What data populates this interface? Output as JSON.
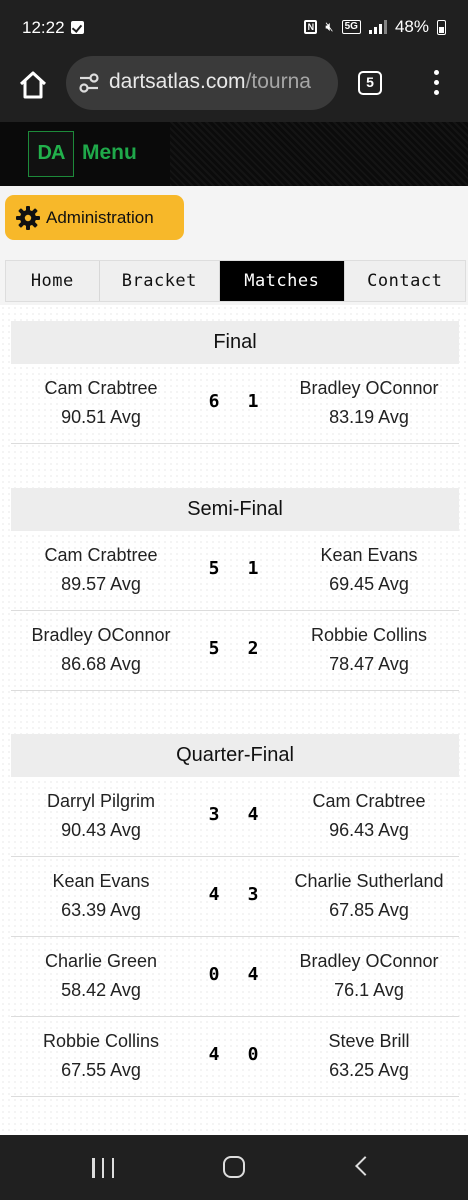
{
  "status_bar": {
    "time": "12:22",
    "battery": "48%",
    "network": "5G"
  },
  "browser": {
    "url_domain": "dartsatlas.com",
    "url_path": "/tourna",
    "tab_count": "5"
  },
  "header": {
    "logo_text": "DA",
    "menu_label": "Menu"
  },
  "admin_button": {
    "label": "Administration"
  },
  "tabs": [
    {
      "label": "Home"
    },
    {
      "label": "Bracket"
    },
    {
      "label": "Matches"
    },
    {
      "label": "Contact"
    }
  ],
  "colors": {
    "accent_yellow": "#f7b82a",
    "brand_green": "#1fa84a",
    "active_tab": "#000000"
  },
  "rounds": [
    {
      "title": "Final",
      "matches": [
        {
          "p1": "Cam Crabtree",
          "p1_avg": "90.51 Avg",
          "s1": "6",
          "s2": "1",
          "p2": "Bradley OConnor",
          "p2_avg": "83.19 Avg"
        }
      ]
    },
    {
      "title": "Semi-Final",
      "matches": [
        {
          "p1": "Cam Crabtree",
          "p1_avg": "89.57 Avg",
          "s1": "5",
          "s2": "1",
          "p2": "Kean Evans",
          "p2_avg": "69.45 Avg"
        },
        {
          "p1": "Bradley OConnor",
          "p1_avg": "86.68 Avg",
          "s1": "5",
          "s2": "2",
          "p2": "Robbie Collins",
          "p2_avg": "78.47 Avg"
        }
      ]
    },
    {
      "title": "Quarter-Final",
      "matches": [
        {
          "p1": "Darryl Pilgrim",
          "p1_avg": "90.43 Avg",
          "s1": "3",
          "s2": "4",
          "p2": "Cam Crabtree",
          "p2_avg": "96.43 Avg"
        },
        {
          "p1": "Kean Evans",
          "p1_avg": "63.39 Avg",
          "s1": "4",
          "s2": "3",
          "p2": "Charlie Sutherland",
          "p2_avg": "67.85 Avg"
        },
        {
          "p1": "Charlie Green",
          "p1_avg": "58.42 Avg",
          "s1": "0",
          "s2": "4",
          "p2": "Bradley OConnor",
          "p2_avg": "76.1 Avg"
        },
        {
          "p1": "Robbie Collins",
          "p1_avg": "67.55 Avg",
          "s1": "4",
          "s2": "0",
          "p2": "Steve Brill",
          "p2_avg": "63.25 Avg"
        }
      ]
    }
  ]
}
